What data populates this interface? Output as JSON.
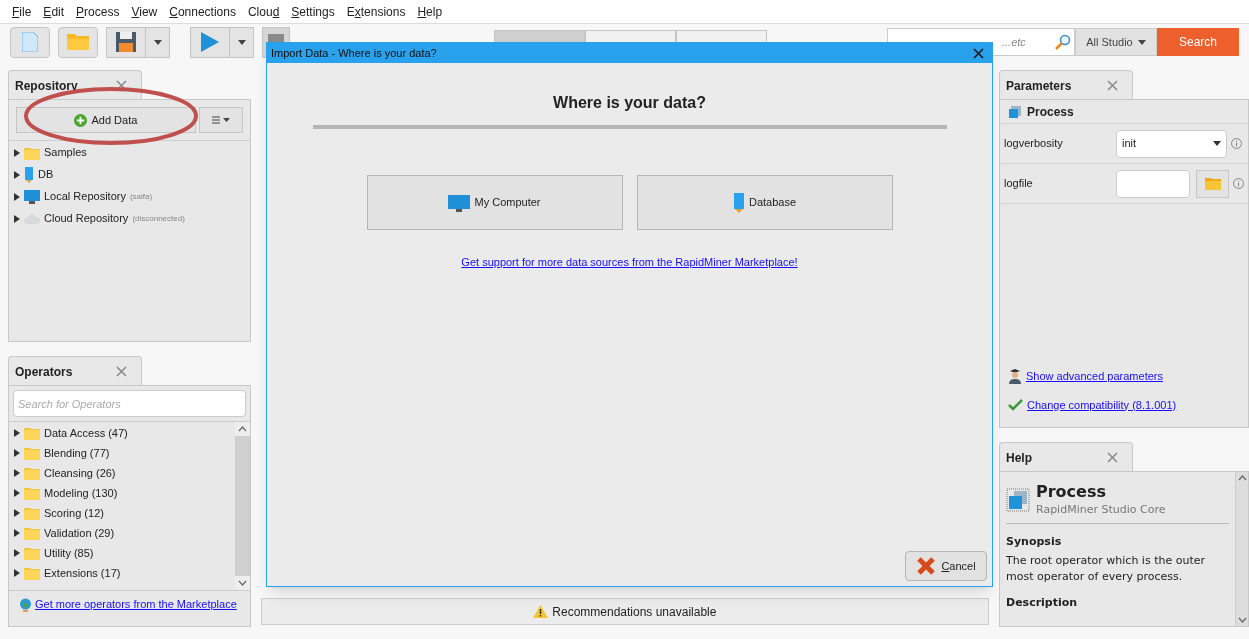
{
  "menu": [
    {
      "key": "F",
      "post": "ile"
    },
    {
      "key": "E",
      "post": "dit"
    },
    {
      "key": "P",
      "post": "rocess"
    },
    {
      "key": "V",
      "post": "iew"
    },
    {
      "key": "C",
      "post": "onnections"
    },
    {
      "pre": "Clou",
      "key": "d"
    },
    {
      "key": "S",
      "post": "ettings"
    },
    {
      "pre": "E",
      "key": "x",
      "post": "tensions"
    },
    {
      "key": "H",
      "post": "elp"
    }
  ],
  "toolbar": {
    "views": [
      {
        "selected": true
      },
      {
        "selected": false
      },
      {
        "selected": false
      }
    ],
    "search": {
      "placeholder": "...etc"
    },
    "scope": "All Studio",
    "search_button": "Search"
  },
  "repository": {
    "title": "Repository",
    "add_button": "Add Data",
    "items": [
      {
        "kind": "folder",
        "label": "Samples"
      },
      {
        "kind": "db",
        "label": "DB"
      },
      {
        "kind": "monitor",
        "label": "Local Repository",
        "note": "(saifa)"
      },
      {
        "kind": "cloud",
        "label": "Cloud Repository",
        "note": "(disconnected)"
      }
    ]
  },
  "operators": {
    "title": "Operators",
    "search": {
      "placeholder": "Search for Operators"
    },
    "items": [
      "Data Access (47)",
      "Blending (77)",
      "Cleansing (26)",
      "Modeling (130)",
      "Scoring (12)",
      "Validation (29)",
      "Utility (85)",
      "Extensions (17)"
    ],
    "marketplace_link": "Get more operators from the Marketplace"
  },
  "center": {
    "status": "Recommendations unavailable"
  },
  "dialog": {
    "title": "Import Data - Where is your data?",
    "heading": "Where is your data?",
    "sources": [
      {
        "kind": "computer",
        "label": "My Computer"
      },
      {
        "kind": "database",
        "label": "Database"
      }
    ],
    "link": "Get support for more data sources from the RapidMiner Marketplace!",
    "cancel": {
      "key": "C",
      "post": "ancel"
    }
  },
  "parameters": {
    "title": "Parameters",
    "operator": "Process",
    "rows": [
      {
        "kind": "select",
        "label": "logverbosity",
        "value": "init"
      },
      {
        "kind": "file",
        "label": "logfile"
      }
    ],
    "links": [
      {
        "kind": "advanced",
        "label": "Show advanced parameters"
      },
      {
        "kind": "compat",
        "label": "Change compatibility (8.1.001)"
      }
    ]
  },
  "help": {
    "title": "Help",
    "operator": "Process",
    "subtitle": "RapidMiner Studio Core",
    "sections": [
      {
        "heading": "Synopsis",
        "text": "The root operator which is the outer most operator of every process."
      },
      {
        "heading": "Description"
      }
    ]
  }
}
